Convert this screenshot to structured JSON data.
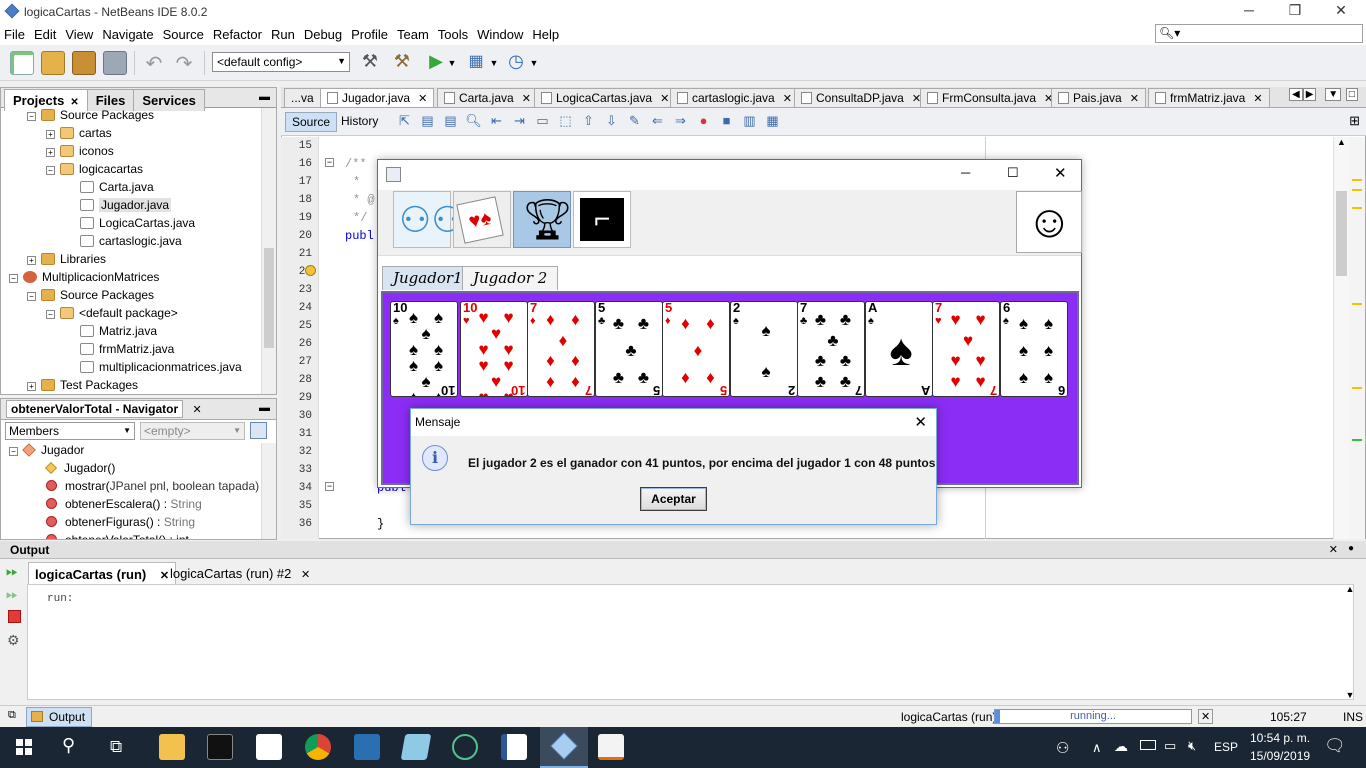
{
  "window": {
    "title": "logicaCartas - NetBeans IDE 8.0.2",
    "minimize": "─",
    "restore": "❐",
    "close": "✕"
  },
  "menu": [
    "File",
    "Edit",
    "View",
    "Navigate",
    "Source",
    "Refactor",
    "Run",
    "Debug",
    "Profile",
    "Team",
    "Tools",
    "Window",
    "Help"
  ],
  "search": {
    "placeholder": ""
  },
  "toolbar": {
    "config": "<default config>"
  },
  "projects_panel": {
    "tabs": [
      "Projects",
      "Files",
      "Services"
    ],
    "tree": [
      {
        "label": "Source Packages",
        "type": "folder"
      },
      {
        "label": "cartas",
        "type": "pkg"
      },
      {
        "label": "iconos",
        "type": "pkg"
      },
      {
        "label": "logicacartas",
        "type": "pkg"
      },
      {
        "label": "Carta.java",
        "type": "java"
      },
      {
        "label": "Jugador.java",
        "type": "java"
      },
      {
        "label": "LogicaCartas.java",
        "type": "java"
      },
      {
        "label": "cartaslogic.java",
        "type": "java"
      },
      {
        "label": "Libraries",
        "type": "folder"
      },
      {
        "label": "MultiplicacionMatrices",
        "type": "project"
      },
      {
        "label": "Source Packages",
        "type": "folder"
      },
      {
        "label": "<default package>",
        "type": "pkg"
      },
      {
        "label": "Matriz.java",
        "type": "java"
      },
      {
        "label": "frmMatriz.java",
        "type": "java"
      },
      {
        "label": "multiplicacionmatrices.java",
        "type": "java"
      },
      {
        "label": "Test Packages",
        "type": "folder"
      }
    ]
  },
  "navigator": {
    "title": "obtenerValorTotal - Navigator",
    "filter": "Members",
    "empty": "<empty>",
    "items": [
      {
        "name": "Jugador",
        "type": ""
      },
      {
        "name": "Jugador()",
        "type": ""
      },
      {
        "name": "mostrar(",
        "params": "JPanel pnl, boolean tapada)",
        "type": ""
      },
      {
        "name": "obtenerEscalera() : ",
        "type": "String"
      },
      {
        "name": "obtenerFiguras() : ",
        "type": "String"
      },
      {
        "name": "obtenerValorTotal() : int",
        "type": ""
      }
    ]
  },
  "editor_tabs": [
    "...va",
    "Jugador.java",
    "Carta.java",
    "LogicaCartas.java",
    "cartaslogic.java",
    "ConsultaDP.java",
    "FrmConsulta.java",
    "Pais.java",
    "frmMatriz.java"
  ],
  "editor": {
    "source_tab": "Source",
    "history_tab": "History",
    "line_numbers": [
      "15",
      "16",
      "17",
      "18",
      "19",
      "20",
      "21",
      "22",
      "23",
      "24",
      "25",
      "26",
      "27",
      "28",
      "29",
      "30",
      "31",
      "32",
      "33",
      "34",
      "35",
      "36"
    ],
    "code_fragments": [
      "/**",
      "*",
      "* @",
      "*/",
      "publ",
      "publ",
      "}"
    ]
  },
  "app_window": {
    "tabs": [
      "Jugador1",
      "Jugador 2"
    ],
    "icon_buttons": [
      "users-icon",
      "cards-icon",
      "trophy-icon",
      "stairs-icon"
    ],
    "smiley": "☺",
    "cards": [
      {
        "rank": "10",
        "suit": "♠",
        "color": "blk",
        "pips": 10
      },
      {
        "rank": "10",
        "suit": "♥",
        "color": "red",
        "pips": 10
      },
      {
        "rank": "7",
        "suit": "♦",
        "color": "red",
        "pips": 7
      },
      {
        "rank": "5",
        "suit": "♣",
        "color": "blk",
        "pips": 5
      },
      {
        "rank": "5",
        "suit": "♦",
        "color": "red",
        "pips": 5
      },
      {
        "rank": "2",
        "suit": "♠",
        "color": "blk",
        "pips": 2
      },
      {
        "rank": "7",
        "suit": "♣",
        "color": "blk",
        "pips": 7
      },
      {
        "rank": "A",
        "suit": "♠",
        "color": "blk",
        "pips": 1
      },
      {
        "rank": "7",
        "suit": "♥",
        "color": "red",
        "pips": 7
      },
      {
        "rank": "6",
        "suit": "♠",
        "color": "blk",
        "pips": 6
      }
    ]
  },
  "dialog": {
    "title": "Mensaje",
    "message": "El jugador 2 es el ganador con 41 puntos, por encima del jugador 1 con 48 puntos",
    "button": "Aceptar",
    "info": "i"
  },
  "output": {
    "title": "Output",
    "tabs": [
      "logicaCartas (run)",
      "logicaCartas (run) #2"
    ],
    "text": "run:"
  },
  "statusbar": {
    "output_label": "Output",
    "project": "logicaCartas (run)",
    "progress": "running...",
    "position": "105:27",
    "mode": "INS"
  },
  "taskbar": {
    "lang": "ESP",
    "time": "10:54 p. m.",
    "date": "15/09/2019"
  }
}
